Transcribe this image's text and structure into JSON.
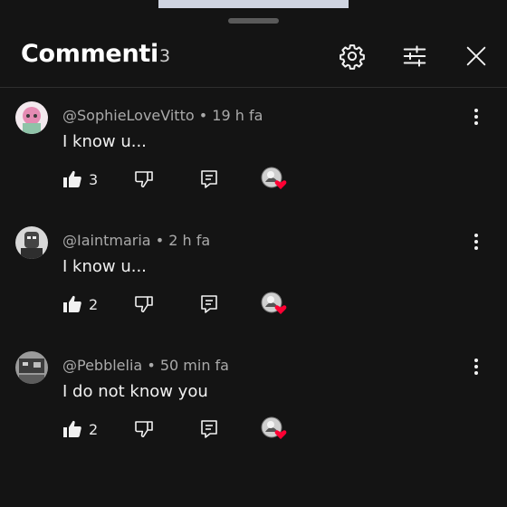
{
  "header": {
    "title": "Commenti",
    "count": "3"
  },
  "comments": [
    {
      "author": "@SophieLoveVitto",
      "separator": "•",
      "time": "19 h fa",
      "text": "I know u...",
      "likes": "3",
      "avatar_color": "#e58bb3"
    },
    {
      "author": "@Iaintmaria",
      "separator": "•",
      "time": "2 h fa",
      "text": "I know u...",
      "likes": "2",
      "avatar_color": "#8a8a8a"
    },
    {
      "author": "@Pebblelia",
      "separator": "•",
      "time": "50 min fa",
      "text": "I do not know you",
      "likes": "2",
      "avatar_color": "#6b6b6b"
    }
  ],
  "icons": {
    "settings": "gear-icon",
    "filter": "sliders-icon",
    "close": "close-icon",
    "like": "thumbs-up-icon",
    "dislike": "thumbs-down-icon",
    "reply": "reply-icon",
    "heart": "creator-heart-icon",
    "more": "vertical-dots-icon"
  },
  "colors": {
    "background": "#141414",
    "heart": "#ff0033",
    "text_primary": "#f1f1f1",
    "text_secondary": "#aaaaaa"
  }
}
